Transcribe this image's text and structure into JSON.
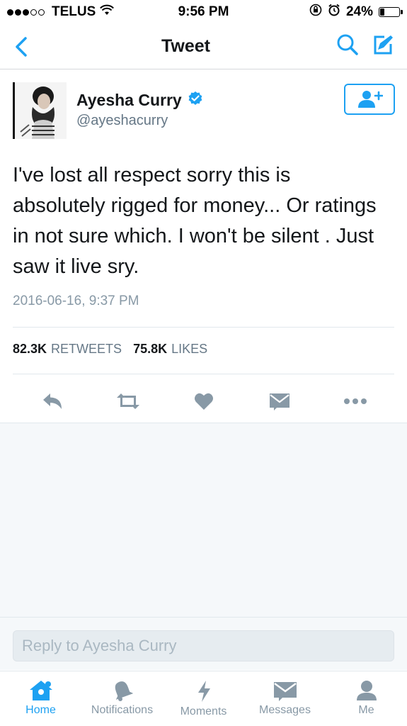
{
  "status_bar": {
    "carrier": "TELUS",
    "time": "9:56 PM",
    "battery": "24%",
    "battery_level": 0.24
  },
  "nav": {
    "title": "Tweet",
    "back_icon": "chevron-left-icon",
    "search_icon": "search-icon",
    "compose_icon": "compose-icon"
  },
  "tweet": {
    "display_name": "Ayesha Curry",
    "handle": "@ayeshacurry",
    "verified": true,
    "text": "I've lost all respect sorry this is absolutely rigged for money... Or ratings in not sure which. I won't be silent . Just saw it live sry.",
    "timestamp": "2016-06-16, 9:37 PM",
    "retweets_count": "82.3K",
    "retweets_label": "RETWEETS",
    "likes_count": "75.8K",
    "likes_label": "LIKES"
  },
  "actions": [
    "reply-icon",
    "retweet-icon",
    "like-icon",
    "direct-message-icon",
    "more-icon"
  ],
  "reply": {
    "placeholder": "Reply to Ayesha Curry"
  },
  "tabs": [
    {
      "label": "Home",
      "icon": "home-icon",
      "active": true
    },
    {
      "label": "Notifications",
      "icon": "notifications-icon",
      "active": false
    },
    {
      "label": "Moments",
      "icon": "moments-icon",
      "active": false
    },
    {
      "label": "Messages",
      "icon": "messages-icon",
      "active": false
    },
    {
      "label": "Me",
      "icon": "me-icon",
      "active": false
    }
  ],
  "colors": {
    "accent": "#1da1f2",
    "text": "#14171a",
    "muted": "#657786",
    "icon_gray": "#8899a6"
  }
}
